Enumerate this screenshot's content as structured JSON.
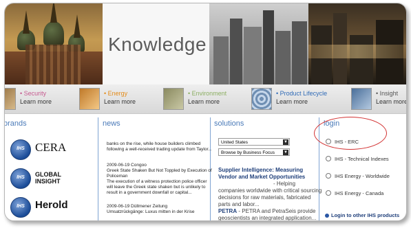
{
  "banner": {
    "title": "Knowledge"
  },
  "categories": [
    {
      "name": "• Security",
      "link": "Learn more",
      "color": "#c65a8f",
      "thumb": "#8f6a3a"
    },
    {
      "name": "• Energy",
      "link": "Learn more",
      "color": "#e38b1a",
      "thumb": "#c07a2a"
    },
    {
      "name": "• Environment",
      "link": "Learn more",
      "color": "#8caf63",
      "thumb": "#8a8a60"
    },
    {
      "name": "• Product Lifecycle",
      "link": "Learn more",
      "color": "#2f6ab6",
      "thumb": "#6f8fb3"
    },
    {
      "name": "• Insight",
      "link": "Learn more",
      "color": "#555555",
      "thumb": "#4a6f9a"
    }
  ],
  "brands": {
    "heading": "brands",
    "items": [
      {
        "logo_text": "IHS",
        "word": "CERA"
      },
      {
        "logo_text": "IHS",
        "word": "GLOBAL\nINSIGHT"
      },
      {
        "logo_text": "IHS",
        "word": "Herold"
      }
    ]
  },
  "news": {
    "heading": "news",
    "intro": "banks on the rise, while house builders climbed following a well-received trading update from Taylor...",
    "items": [
      {
        "date": "2009-06-19 Congoo",
        "headline": "Greek State Shaken But Not Toppled by Execution of Policeman",
        "body": "The execution of a witness protection police officer will leave the Greek state shaken but is unlikely to result in a government downfall or capital..."
      },
      {
        "date": "2009-06-19 Düllmener Zeitung",
        "headline": "Umsatzrückgänge: Luxus mitten in der Krise",
        "body": ""
      }
    ]
  },
  "solutions": {
    "heading": "solutions",
    "country_select": "United States",
    "focus_select": "Browse by Business Focus",
    "items": [
      {
        "title": "Supplier Intelligence: Measuring Vendor and Market Opportunities",
        "desc": " - Helping companies worldwide with critical sourcing decisions for raw materials, fabricated parts and labor..."
      },
      {
        "title": "PETRA",
        "desc": " - PETRA and PetraSeis provide geoscientists an integrated application..."
      }
    ]
  },
  "login": {
    "heading": "login",
    "options": [
      "IHS - ERC",
      "IHS - Technical Indexes",
      "IHS Energy - Worldwide",
      "IHS Energy - Canada"
    ],
    "other": "Login to other IHS products"
  },
  "colors": {
    "heading_blue": "#4a7ab8",
    "link_blue": "#1f3f7a",
    "highlight_red": "#d23030"
  }
}
